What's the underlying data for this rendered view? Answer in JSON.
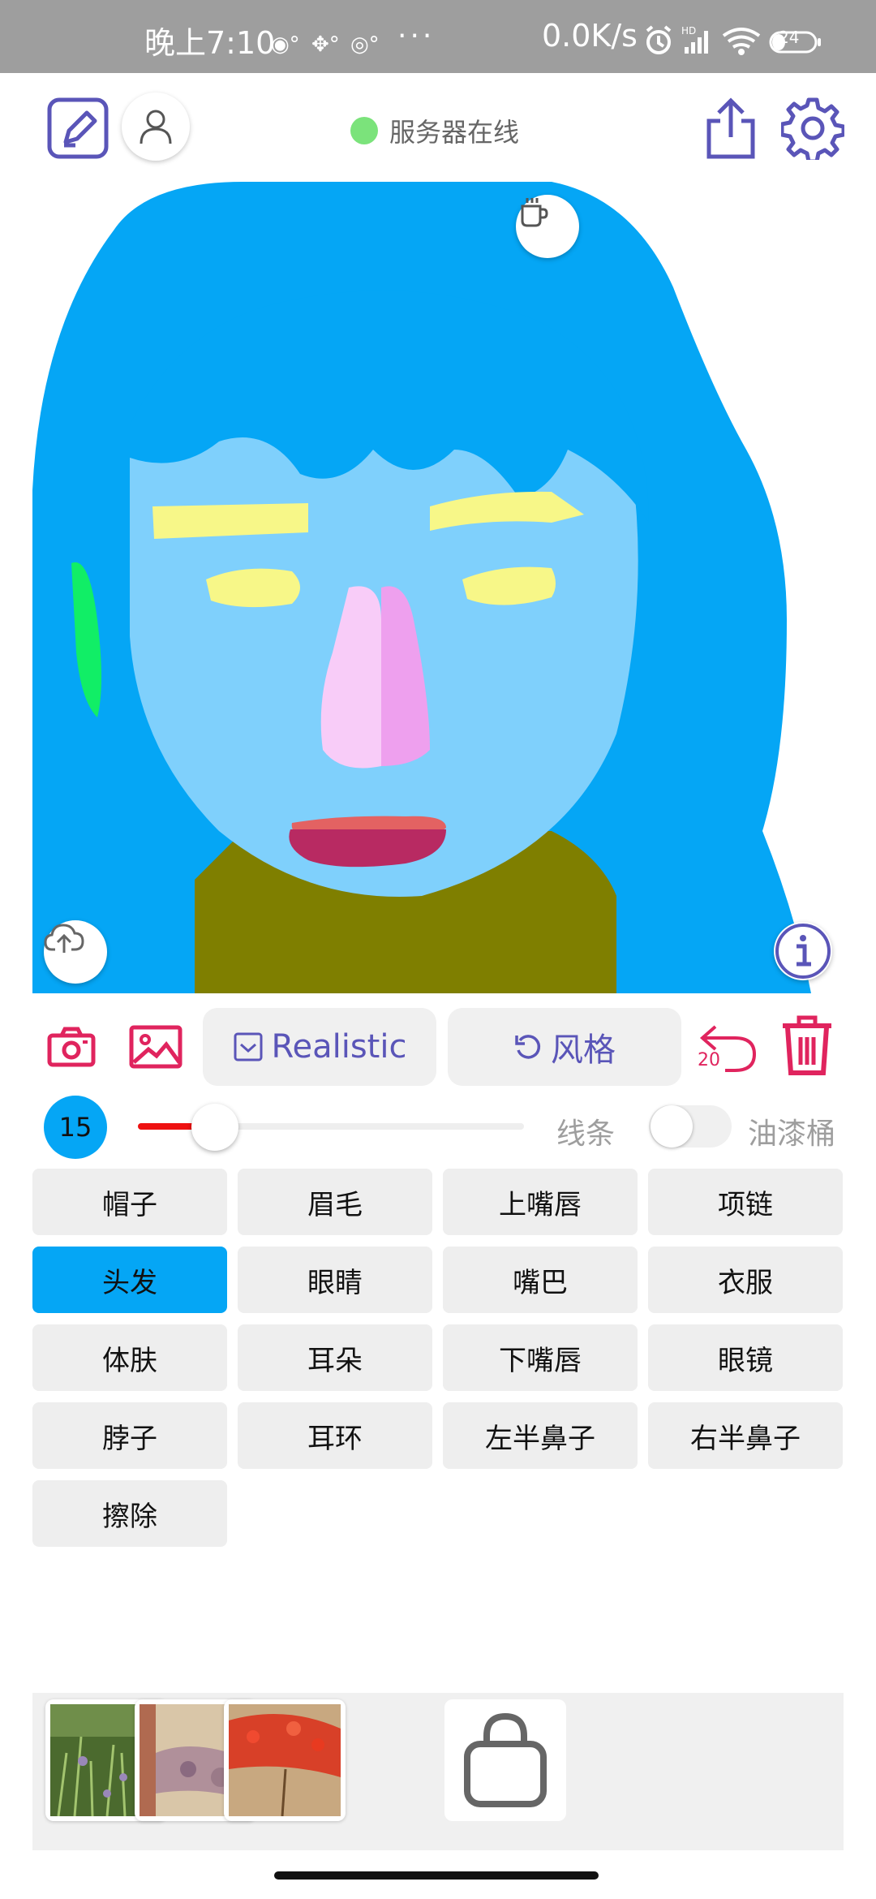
{
  "status_bar": {
    "time": "晚上7:10",
    "network_speed": "0.0K/s",
    "battery_level": "24",
    "icons": [
      "notification-icon",
      "notification-icon",
      "notification-icon",
      "alarm-icon",
      "signal-icon",
      "wifi-icon",
      "battery-icon"
    ]
  },
  "header": {
    "server_status": "服务器在线",
    "status_color": "#7be37b"
  },
  "toolbar": {
    "realistic_label": "Realistic",
    "style_label": "风格",
    "undo_count": "20",
    "accent_color": "#e0245e",
    "primary_color": "#5a55b8"
  },
  "brush": {
    "size": "15",
    "slider_fraction": 0.2,
    "mode_lines": "线条",
    "mode_bucket": "油漆桶",
    "bucket_enabled": false
  },
  "labels": [
    {
      "text": "帽子",
      "selected": false
    },
    {
      "text": "眉毛",
      "selected": false
    },
    {
      "text": "上嘴唇",
      "selected": false
    },
    {
      "text": "项链",
      "selected": false
    },
    {
      "text": "头发",
      "selected": true
    },
    {
      "text": "眼睛",
      "selected": false
    },
    {
      "text": "嘴巴",
      "selected": false
    },
    {
      "text": "衣服",
      "selected": false
    },
    {
      "text": "体肤",
      "selected": false
    },
    {
      "text": "耳朵",
      "selected": false
    },
    {
      "text": "下嘴唇",
      "selected": false
    },
    {
      "text": "眼镜",
      "selected": false
    },
    {
      "text": "脖子",
      "selected": false
    },
    {
      "text": "耳环",
      "selected": false
    },
    {
      "text": "左半鼻子",
      "selected": false
    },
    {
      "text": "右半鼻子",
      "selected": false
    },
    {
      "text": "擦除",
      "selected": false
    }
  ],
  "selected_color": "#05a6f5"
}
